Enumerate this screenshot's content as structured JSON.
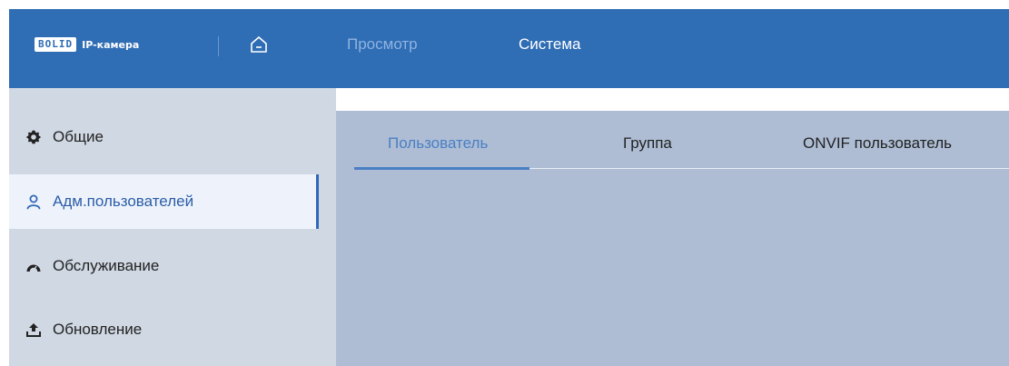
{
  "header": {
    "brand_logo": "BOLID",
    "brand_product": "IP-камера",
    "nav": [
      {
        "label": "Просмотр",
        "active": false
      },
      {
        "label": "Система",
        "active": true
      }
    ],
    "color": "#2f6db5"
  },
  "sidebar": {
    "items": [
      {
        "label": "Общие",
        "icon": "gear-icon",
        "active": false
      },
      {
        "label": "Адм.пользователей",
        "icon": "user-icon",
        "active": true
      },
      {
        "label": "Обслуживание",
        "icon": "gauge-icon",
        "active": false
      },
      {
        "label": "Обновление",
        "icon": "upload-icon",
        "active": false
      }
    ],
    "active_color": "#3168b6"
  },
  "main": {
    "tabs": [
      {
        "label": "Пользователь",
        "active": true
      },
      {
        "label": "Группа",
        "active": false
      },
      {
        "label": "ONVIF пользователь",
        "active": false
      }
    ]
  }
}
